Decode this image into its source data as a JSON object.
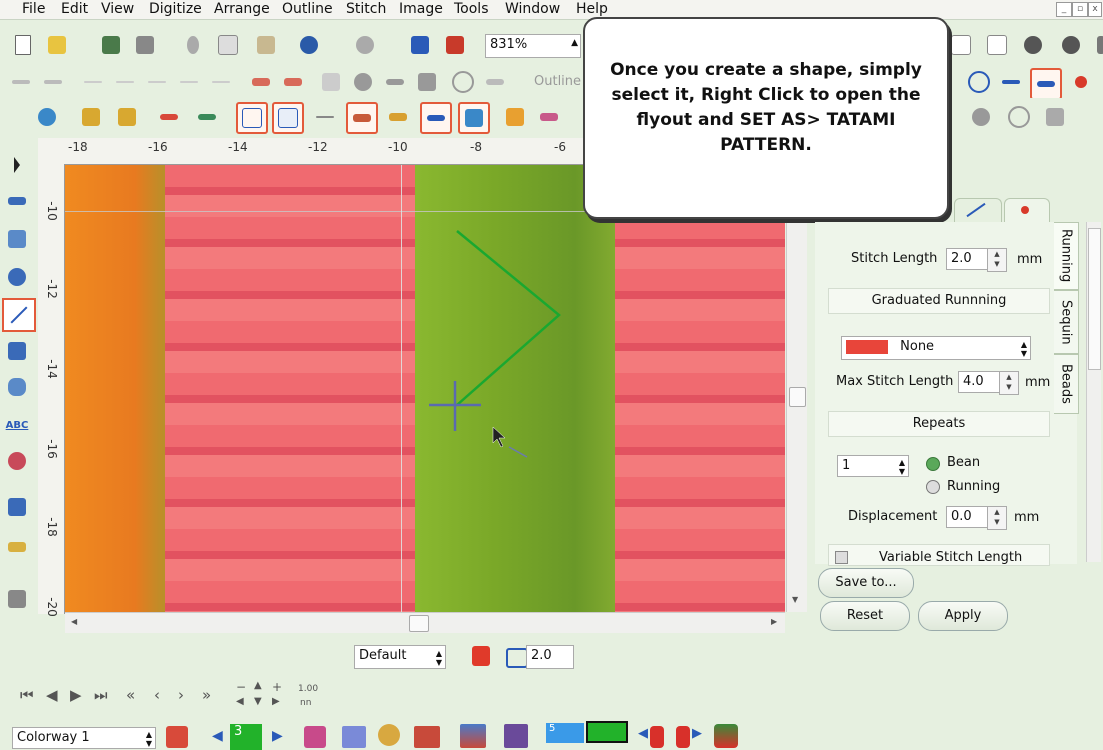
{
  "menubar": {
    "items": [
      "File",
      "Edit",
      "View",
      "Digitize",
      "Arrange",
      "Outline",
      "Stitch",
      "Image",
      "Tools",
      "Window",
      "Help"
    ]
  },
  "toolbar": {
    "zoom_value": "831%",
    "outline_label": "Outline"
  },
  "ruler": {
    "h_ticks": [
      "-18",
      "-16",
      "-14",
      "-12",
      "-10",
      "-8",
      "-6"
    ],
    "v_ticks": [
      "-10",
      "-12",
      "-14",
      "-16",
      "-18",
      "-20"
    ]
  },
  "tooltip": {
    "text": "Once you create a shape, simply select it, Right Click to open the flyout and SET AS> TATAMI PATTERN."
  },
  "panel": {
    "stitch_length_label": "Stitch Length",
    "stitch_length_value": "2.0",
    "unit_mm": "mm",
    "graduated_header": "Graduated Runnning",
    "graduated_select": "None",
    "graduated_color": "#e8453a",
    "max_stitch_label": "Max Stitch Length",
    "max_stitch_value": "4.0",
    "repeats_header": "Repeats",
    "repeats_value": "1",
    "radio_bean": "Bean",
    "radio_running": "Running",
    "displacement_label": "Displacement",
    "displacement_value": "0.0",
    "variable_label": "Variable Stitch Length",
    "tabs": [
      "Running",
      "Sequin",
      "Beads"
    ]
  },
  "buttons": {
    "save_to": "Save to...",
    "reset": "Reset",
    "apply": "Apply"
  },
  "status": {
    "default_select": "Default",
    "stitch_value": "2.0",
    "scale_label": "1.00",
    "nn_label": "nn",
    "colorway": "Colorway 1",
    "color_number": "3",
    "swatch_value": "5"
  }
}
